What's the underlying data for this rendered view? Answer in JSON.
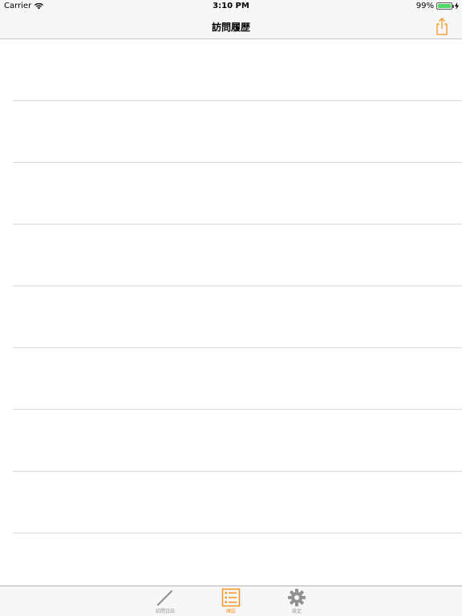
{
  "status_bar": {
    "carrier": "Carrier",
    "time": "3:10 PM",
    "battery_percent": "99%",
    "battery_level": 0.99
  },
  "nav_bar": {
    "title": "訪問履歴",
    "share_icon": "share-icon"
  },
  "table": {
    "rows": [
      "",
      "",
      "",
      "",
      "",
      "",
      "",
      "",
      ""
    ]
  },
  "tab_bar": {
    "tabs": [
      {
        "label": "訪問日誌",
        "icon": "pencil-icon",
        "active": false
      },
      {
        "label": "確認",
        "icon": "list-icon",
        "active": true
      },
      {
        "label": "設定",
        "icon": "gear-icon",
        "active": false
      }
    ]
  },
  "colors": {
    "accent": "#f7931e",
    "inactive": "#929292",
    "battery": "#4cd964",
    "separator": "#dcdcdc"
  }
}
